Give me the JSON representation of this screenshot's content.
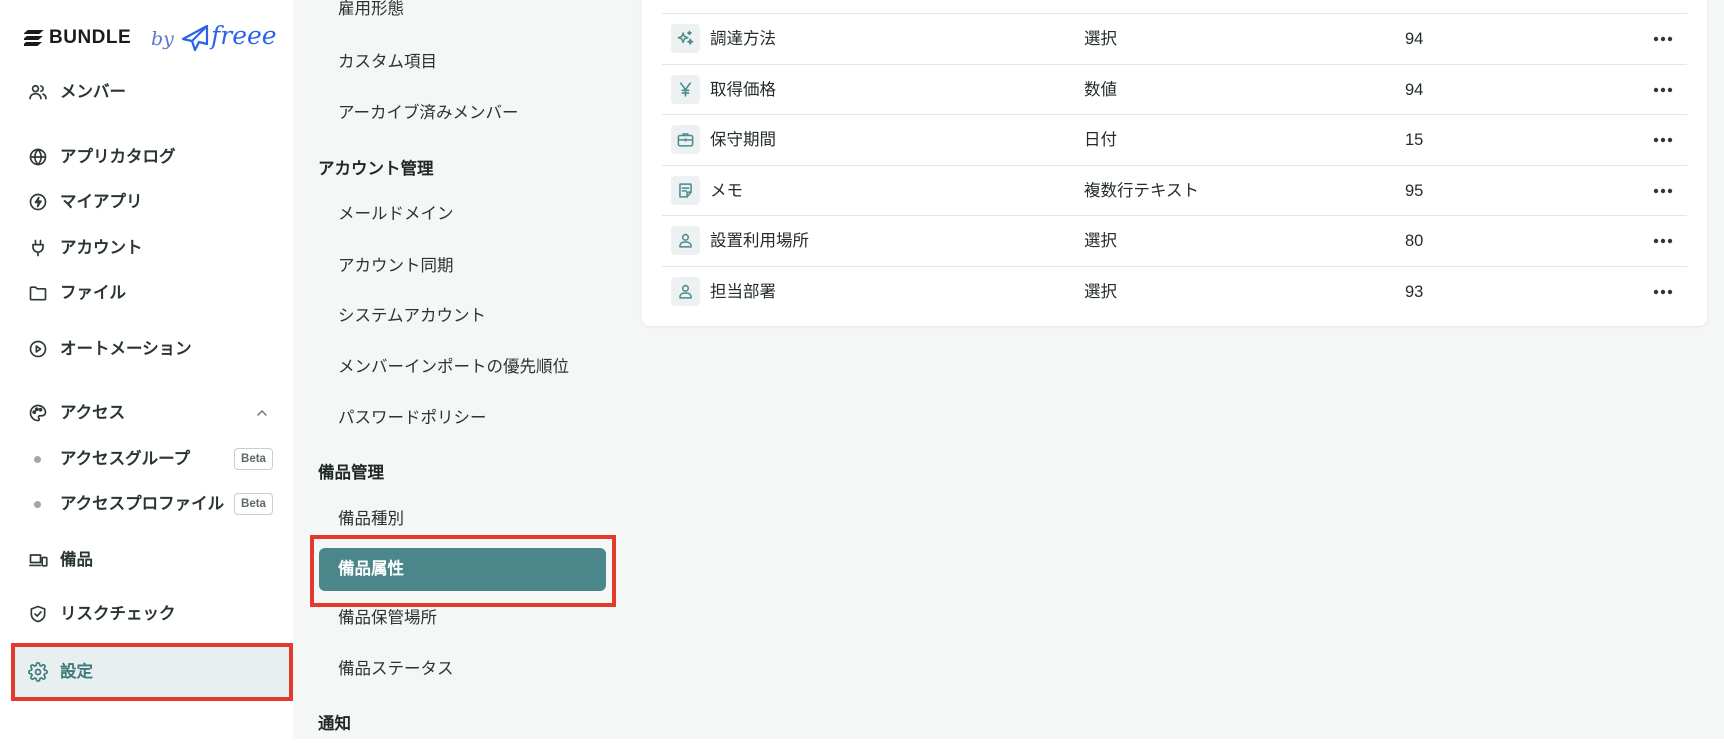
{
  "app": {
    "brand": "BUNDLE",
    "by": "by",
    "partner": "freee"
  },
  "colors": {
    "accent": "#4b878a",
    "selected_bg": "#e8f0ef",
    "annotation": "#e23b2e",
    "surface": "#f5f6f6"
  },
  "sidebar": {
    "items": [
      {
        "label": "メンバー",
        "icon": "users-icon"
      },
      {
        "label": "アプリカタログ",
        "icon": "globe-icon"
      },
      {
        "label": "マイアプリ",
        "icon": "bolt-circle-icon"
      },
      {
        "label": "アカウント",
        "icon": "plug-icon"
      },
      {
        "label": "ファイル",
        "icon": "folder-icon"
      },
      {
        "label": "オートメーション",
        "icon": "play-circle-icon"
      },
      {
        "label": "アクセス",
        "icon": "palette-icon",
        "expanded": true,
        "children": [
          {
            "label": "アクセスグループ",
            "badge": "Beta"
          },
          {
            "label": "アクセスプロファイル",
            "badge": "Beta"
          }
        ]
      },
      {
        "label": "備品",
        "icon": "device-icon"
      },
      {
        "label": "リスクチェック",
        "icon": "shield-check-icon"
      },
      {
        "label": "設定",
        "icon": "gear-icon",
        "selected": true
      }
    ]
  },
  "settings_nav": {
    "top_items": [
      "雇用形態",
      "カスタム項目",
      "アーカイブ済みメンバー"
    ],
    "sections": [
      {
        "heading": "アカウント管理",
        "items": [
          "メールドメイン",
          "アカウント同期",
          "システムアカウント",
          "メンバーインポートの優先順位",
          "パスワードポリシー"
        ]
      },
      {
        "heading": "備品管理",
        "items": [
          "備品種別",
          "備品属性",
          "備品保管場所",
          "備品ステータス"
        ],
        "selected_index": 1
      },
      {
        "heading": "通知",
        "items": []
      }
    ]
  },
  "attributes_table": {
    "rows": [
      {
        "name": "調達方法",
        "type": "選択",
        "count": 94,
        "icon": "sparkles-icon"
      },
      {
        "name": "取得価格",
        "type": "数値",
        "count": 94,
        "icon": "yen-icon"
      },
      {
        "name": "保守期間",
        "type": "日付",
        "count": 15,
        "icon": "toolbox-icon"
      },
      {
        "name": "メモ",
        "type": "複数行テキスト",
        "count": 95,
        "icon": "note-icon"
      },
      {
        "name": "設置利用場所",
        "type": "選択",
        "count": 80,
        "icon": "person-icon"
      },
      {
        "name": "担当部署",
        "type": "選択",
        "count": 93,
        "icon": "person-icon"
      }
    ],
    "row_action_icon": "more-horizontal-icon"
  }
}
